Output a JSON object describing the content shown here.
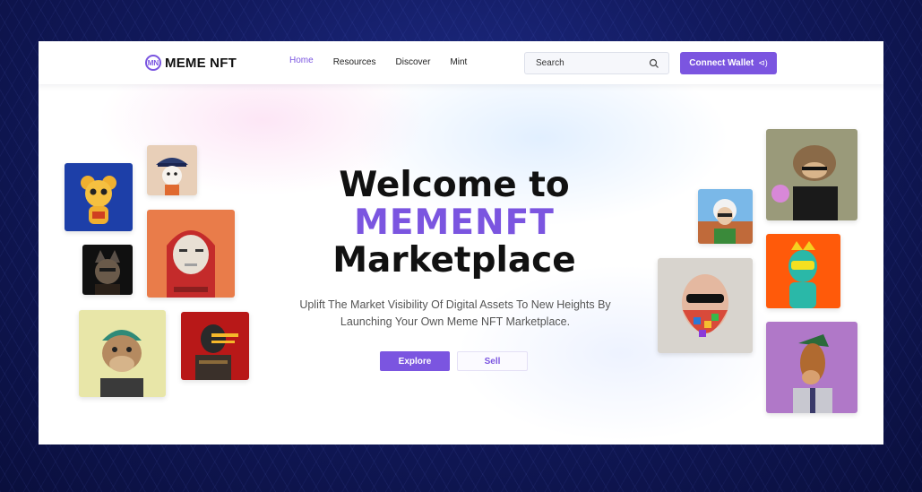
{
  "brand": {
    "logo_mark": "MN",
    "name": "MEME NFT"
  },
  "nav": {
    "items": [
      {
        "label": "Home",
        "active": true
      },
      {
        "label": "Resources",
        "active": false
      },
      {
        "label": "Discover",
        "active": false
      },
      {
        "label": "Mint",
        "active": false
      }
    ]
  },
  "search": {
    "value": "Search",
    "icon": "search-icon"
  },
  "connect_wallet": {
    "label": "Connect Wallet",
    "icon": "wallet-icon"
  },
  "hero": {
    "line1": "Welcome to",
    "line2": "MEMENFT",
    "line3": "Marketplace",
    "subtitle_line1": "Uplift The Market Visibility Of Digital Assets To New Heights By",
    "subtitle_line2": "Launching Your Own Meme NFT Marketplace.",
    "explore_label": "Explore",
    "sell_label": "Sell"
  },
  "colors": {
    "accent": "#7b55e0",
    "background": "#121a5e"
  },
  "nft_cards": [
    "nft-bear",
    "nft-captain-penguin",
    "nft-hooded-zombie",
    "nft-wolf",
    "nft-ape-beanie",
    "nft-robot-soldier",
    "nft-einstein",
    "nft-mosaic-beard",
    "nft-monkey-op",
    "nft-crown-guy",
    "nft-horse-gentleman"
  ]
}
